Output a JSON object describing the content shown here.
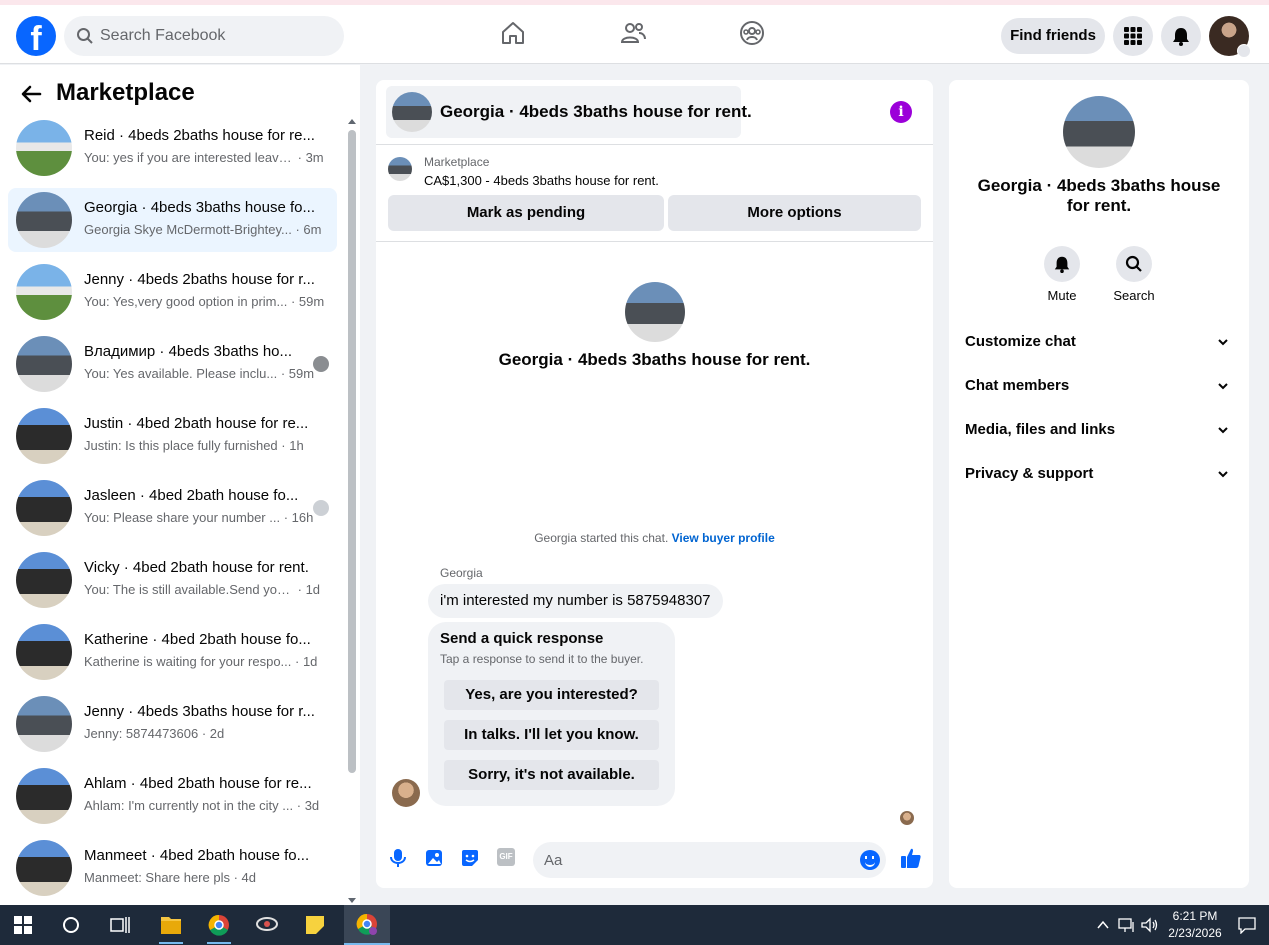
{
  "topbar": {
    "search_placeholder": "Search Facebook",
    "find_friends": "Find friends",
    "logo_glyph": "f"
  },
  "left": {
    "title": "Marketplace",
    "conversations": [
      {
        "name": "Reid · 4beds 2baths house for re...",
        "snippet": "You: yes if you are interested leave...",
        "time": "3m"
      },
      {
        "name": "Georgia · 4beds 3baths house fo...",
        "snippet": "Georgia Skye McDermott-Brightey...",
        "time": "6m"
      },
      {
        "name": "Jenny · 4beds 2baths house for r...",
        "snippet": "You: Yes,very good option in prim...",
        "time": "59m"
      },
      {
        "name": "Владимир · 4beds 3baths ho...",
        "snippet": "You: Yes available. Please inclu...",
        "time": "59m"
      },
      {
        "name": "Justin · 4bed 2bath house for re...",
        "snippet": "Justin: Is this place fully furnished",
        "time": "1h"
      },
      {
        "name": "Jasleen · 4bed 2bath house fo...",
        "snippet": "You: Please share your number ...",
        "time": "16h"
      },
      {
        "name": "Vicky · 4bed 2bath house for rent.",
        "snippet": "You: The is still available.Send your ...",
        "time": "1d"
      },
      {
        "name": "Katherine · 4bed 2bath house fo...",
        "snippet": "Katherine is waiting for your respo...",
        "time": "1d"
      },
      {
        "name": "Jenny · 4beds 3baths house for r...",
        "snippet": "Jenny: 5874473606",
        "time": "2d"
      },
      {
        "name": "Ahlam · 4bed 2bath house for re...",
        "snippet": "Ahlam: I'm currently not in the city ...",
        "time": "3d"
      },
      {
        "name": "Manmeet · 4bed 2bath house fo...",
        "snippet": "Manmeet: Share here pls",
        "time": "4d"
      }
    ]
  },
  "chat": {
    "title": "Georgia · 4beds 3baths house for rent.",
    "listing_source": "Marketplace",
    "listing_price": "CA$1,300 - 4beds 3baths house for rent.",
    "mark_pending": "Mark as pending",
    "more_options": "More options",
    "center_title": "Georgia · 4beds 3baths house for rent.",
    "started_text": "Georgia started this chat.",
    "view_profile": "View buyer profile",
    "sender": "Georgia",
    "message": "i'm interested my number is 5875948307",
    "quick_title": "Send a quick response",
    "quick_sub": "Tap a response to send it to the buyer.",
    "quick_options": [
      "Yes, are you interested?",
      "In talks. I'll let you know.",
      "Sorry, it's not available."
    ],
    "composer_placeholder": "Aa",
    "gif_label": "GIF"
  },
  "right": {
    "title": "Georgia · 4beds 3baths house for rent.",
    "mute": "Mute",
    "search": "Search",
    "sections": [
      "Customize chat",
      "Chat members",
      "Media, files and links",
      "Privacy & support"
    ]
  },
  "taskbar": {
    "time": "6:21 PM",
    "date": "2/23/2026"
  },
  "colors": {
    "brand_blue": "#0866ff",
    "info_purple": "#9b00d9",
    "link_blue": "#0064d1"
  }
}
